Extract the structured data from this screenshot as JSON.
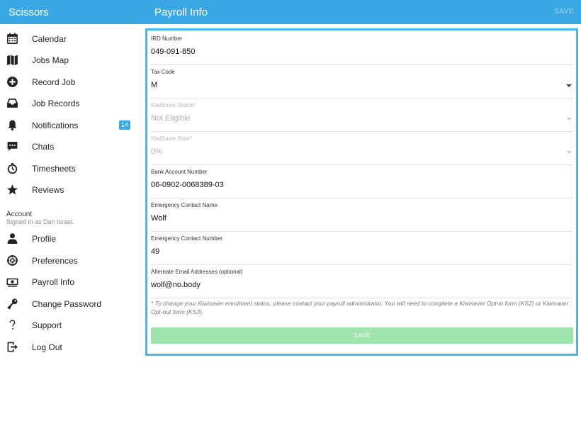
{
  "app": {
    "title": "Scissors"
  },
  "header": {
    "title": "Payroll Info",
    "save_label": "SAVE"
  },
  "sidebar": {
    "items": [
      {
        "label": "Calendar",
        "icon": "calendar-icon"
      },
      {
        "label": "Jobs Map",
        "icon": "map-icon"
      },
      {
        "label": "Record Job",
        "icon": "plus-circle-icon"
      },
      {
        "label": "Job Records",
        "icon": "inbox-icon"
      },
      {
        "label": "Notifications",
        "icon": "bell-icon",
        "badge": "14"
      },
      {
        "label": "Chats",
        "icon": "chat-icon"
      },
      {
        "label": "Timesheets",
        "icon": "stopwatch-icon"
      },
      {
        "label": "Reviews",
        "icon": "star-icon"
      }
    ],
    "account": {
      "heading": "Account",
      "signed_in": "Signed in as Dan Israel.",
      "items": [
        {
          "label": "Profile",
          "icon": "person-icon"
        },
        {
          "label": "Preferences",
          "icon": "gear-icon"
        },
        {
          "label": "Payroll Info",
          "icon": "money-icon"
        },
        {
          "label": "Change Password",
          "icon": "key-icon"
        },
        {
          "label": "Support",
          "icon": "question-icon"
        },
        {
          "label": "Log Out",
          "icon": "logout-icon"
        }
      ]
    }
  },
  "form": {
    "fields": [
      {
        "label": "IRD Number",
        "value": "049-091-850"
      },
      {
        "label": "Tax Code",
        "value": "M",
        "dropdown": true
      },
      {
        "label": "KiwiSaver Status*",
        "value": "Not Eligible",
        "dropdown": true,
        "disabled": true
      },
      {
        "label": "KiwiSaver Rate*",
        "value": "0%",
        "dropdown": true,
        "disabled": true
      },
      {
        "label": "Bank Account Number",
        "value": "06-0902-0068389-03"
      },
      {
        "label": "Emergency Contact Name",
        "value": "Wolf"
      },
      {
        "label": "Emergency Contact Number",
        "value": "49"
      },
      {
        "label": "Alternate Email Addresses (optional)",
        "value": "wolf@no.body"
      }
    ],
    "note": "* To change your Kiwisaver enrolment status, please contact your payroll administrator. You will need to complete a Kiwisaver Opt-in form (KS2) or Kiwisaver Opt-out form (KS3).",
    "save_label": "SAVE"
  },
  "colors": {
    "header": "#3aa8e4",
    "panel_border": "#3ebaf0",
    "badge": "#3aa8e4",
    "save_button": "#9fe3ad"
  }
}
